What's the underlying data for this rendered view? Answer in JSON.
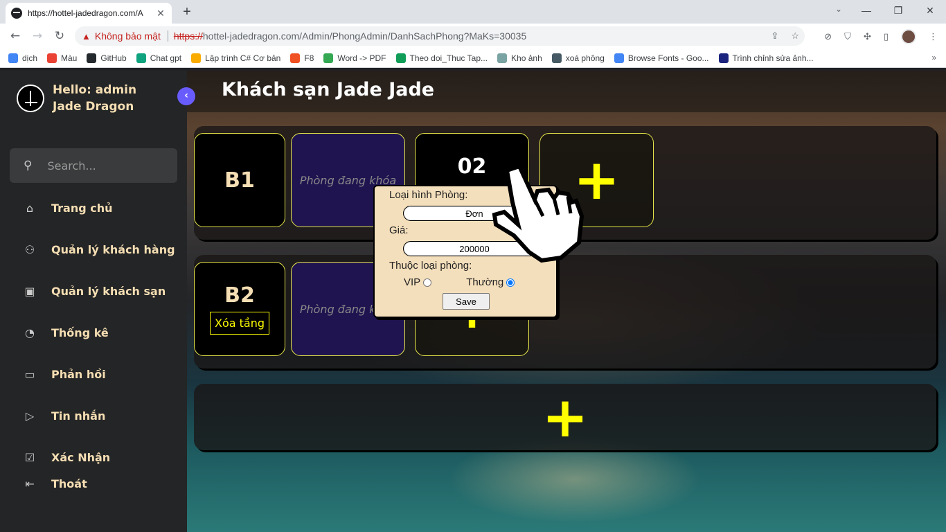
{
  "browser": {
    "tab_title": "https://hottel-jadedragon.com/A",
    "url_warning": "Không bảo mật",
    "url_scheme": "https://",
    "url_rest": "hottel-jadedragon.com/Admin/PhongAdmin/DanhSachPhong?MaKs=30035",
    "bookmarks": [
      {
        "label": "dịch",
        "color": "#4285f4"
      },
      {
        "label": "Màu",
        "color": "#ea4335"
      },
      {
        "label": "GitHub",
        "color": "#24292e"
      },
      {
        "label": "Chat gpt",
        "color": "#10a37f"
      },
      {
        "label": "Lập trình C# Cơ bản",
        "color": "#f9ab00"
      },
      {
        "label": "F8",
        "color": "#f05123"
      },
      {
        "label": "Word -> PDF",
        "color": "#34a853"
      },
      {
        "label": "Theo doi_Thuc Tap...",
        "color": "#0f9d58"
      },
      {
        "label": "Kho ảnh",
        "color": "#7aa3a3"
      },
      {
        "label": "xoá phông",
        "color": "#455a64"
      },
      {
        "label": "Browse Fonts - Goo...",
        "color": "#4285f4"
      },
      {
        "label": "Trình chỉnh sửa ảnh...",
        "color": "#1a237e"
      }
    ]
  },
  "sidebar": {
    "greeting": "Hello: admin",
    "brand": "Jade Dragon",
    "search_placeholder": "Search...",
    "items": [
      {
        "label": "Trang chủ",
        "icon": "home-icon",
        "glyph": "⌂"
      },
      {
        "label": "Quản lý khách hàng",
        "icon": "user-x-icon",
        "glyph": "⚇"
      },
      {
        "label": "Quản lý khách sạn",
        "icon": "hotel-icon",
        "glyph": "▣"
      },
      {
        "label": "Thống kê",
        "icon": "pie-chart-icon",
        "glyph": "◔"
      },
      {
        "label": "Phản hồi",
        "icon": "comment-icon",
        "glyph": "▭"
      },
      {
        "label": "Tin nhắn",
        "icon": "send-icon",
        "glyph": "▷"
      },
      {
        "label": "Xác Nhận",
        "icon": "check-square-icon",
        "glyph": "☑"
      }
    ],
    "logout": {
      "label": "Thoát",
      "icon": "logout-icon",
      "glyph": "⇤"
    }
  },
  "main": {
    "title": "Khách sạn Jade Jade",
    "floors": [
      {
        "name": "B1",
        "locked_text": "Phòng đang khóa",
        "room": "02",
        "add": "+"
      },
      {
        "name": "B2",
        "delete_label": "Xóa tầng",
        "locked_text": "Phòng đang khóa",
        "add": "+"
      }
    ],
    "add_floor": "+"
  },
  "popup": {
    "room_type_label": "Loại hình Phòng:",
    "room_type_value": "Đơn",
    "price_label": "Giá:",
    "price_value": "200000",
    "category_label": "Thuộc loại phòng:",
    "vip_label": "VIP",
    "normal_label": "Thường",
    "selected": "Thường",
    "save_label": "Save"
  }
}
